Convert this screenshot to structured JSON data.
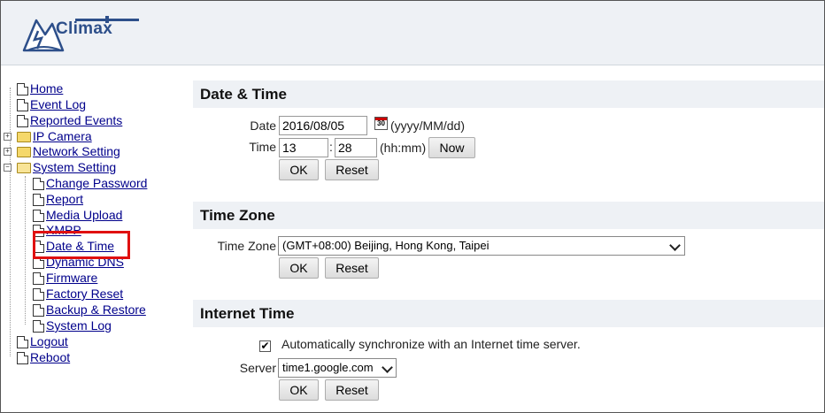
{
  "app": {
    "logo_text": "Climax",
    "logo_icon": "mountain-lightning-logo"
  },
  "sidebar": {
    "items": [
      {
        "label": "Home",
        "type": "doc"
      },
      {
        "label": "Event Log",
        "type": "doc"
      },
      {
        "label": "Reported Events",
        "type": "doc"
      },
      {
        "label": "IP Camera",
        "type": "folder",
        "expander": "+"
      },
      {
        "label": "Network Setting",
        "type": "folder",
        "expander": "+"
      },
      {
        "label": "System Setting",
        "type": "folder-open",
        "expander": "−"
      },
      {
        "label": "Change Password",
        "type": "doc",
        "child": true
      },
      {
        "label": "Report",
        "type": "doc",
        "child": true
      },
      {
        "label": "Media Upload",
        "type": "doc",
        "child": true
      },
      {
        "label": "XMPP",
        "type": "doc",
        "child": true
      },
      {
        "label": "Date & Time",
        "type": "doc",
        "child": true,
        "selected": true
      },
      {
        "label": "Dynamic DNS",
        "type": "doc",
        "child": true
      },
      {
        "label": "Firmware",
        "type": "doc",
        "child": true
      },
      {
        "label": "Factory Reset",
        "type": "doc",
        "child": true
      },
      {
        "label": "Backup & Restore",
        "type": "doc",
        "child": true
      },
      {
        "label": "System Log",
        "type": "doc",
        "child": true
      },
      {
        "label": "Logout",
        "type": "doc"
      },
      {
        "label": "Reboot",
        "type": "doc"
      }
    ]
  },
  "date_time": {
    "title": "Date & Time",
    "date_label": "Date",
    "date_value": "2016/08/05",
    "calendar_icon_text": "30",
    "date_format": "(yyyy/MM/dd)",
    "time_label": "Time",
    "hour_value": "13",
    "time_sep": ":",
    "minute_value": "28",
    "time_format": "(hh:mm)",
    "now_label": "Now",
    "ok_label": "OK",
    "reset_label": "Reset"
  },
  "time_zone": {
    "title": "Time Zone",
    "tz_label": "Time Zone",
    "tz_value": "(GMT+08:00) Beijing, Hong Kong, Taipei",
    "ok_label": "OK",
    "reset_label": "Reset"
  },
  "internet_time": {
    "title": "Internet Time",
    "auto_sync_checked": true,
    "auto_sync_label": "Automatically synchronize with an Internet time server.",
    "check_mark": "✔",
    "server_label": "Server",
    "server_value": "time1.google.com",
    "ok_label": "OK",
    "reset_label": "Reset"
  },
  "colors": {
    "header_bg": "#eef1f5",
    "link": "#00008b",
    "highlight": "#e01010",
    "brand": "#2d4f8a"
  }
}
